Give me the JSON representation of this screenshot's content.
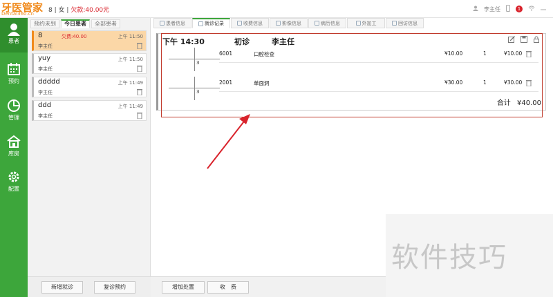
{
  "app": {
    "logo_cn": "牙医管家",
    "logo_en": "Dental360.cn"
  },
  "patient_bar": {
    "id": "8",
    "sep1": "|",
    "gender": "女",
    "sep2": "|",
    "owe": "欠款:40.00元"
  },
  "top_right": {
    "user": "李主任",
    "badge": "1"
  },
  "sidebar": {
    "items": [
      {
        "label": "患者",
        "icon": "user-icon"
      },
      {
        "label": "预约",
        "icon": "calendar-icon"
      },
      {
        "label": "管理",
        "icon": "pie-chart-icon"
      },
      {
        "label": "库房",
        "icon": "warehouse-icon"
      },
      {
        "label": "配置",
        "icon": "gear-icon"
      }
    ]
  },
  "patient_tabs": [
    "预约未到",
    "今日患者",
    "全部患者"
  ],
  "patients": [
    {
      "name": "8",
      "owe": "欠费:40.00",
      "time": "上午 11:50",
      "doctor": "李主任"
    },
    {
      "name": "yuy",
      "owe": "",
      "time": "上午 11:50",
      "doctor": "李主任"
    },
    {
      "name": "ddddd",
      "owe": "",
      "time": "上午 11:49",
      "doctor": "李主任"
    },
    {
      "name": "ddd",
      "owe": "",
      "time": "上午 11:49",
      "doctor": "李主任"
    }
  ],
  "patient_buttons": {
    "new_visit": "新增就诊",
    "revisit": "复诊预约"
  },
  "main_tabs": [
    "患者信息",
    "就诊记录",
    "收费信息",
    "影像信息",
    "病历信息",
    "外加工",
    "回访信息"
  ],
  "record": {
    "time": "下午 14:30",
    "type": "初诊",
    "doctor": "李主任",
    "items": [
      {
        "tooth": "3",
        "code": "6001",
        "name": "口腔检查",
        "price": "¥10.00",
        "qty": "1",
        "amount": "¥10.00"
      },
      {
        "tooth": "3",
        "code": "2001",
        "name": "单面洞",
        "price": "¥30.00",
        "qty": "1",
        "amount": "¥30.00"
      }
    ],
    "total_label": "合计",
    "total_value": "¥40.00"
  },
  "main_buttons": {
    "add": "增加处置",
    "charge": "收　费"
  },
  "watermark": "软件技巧",
  "colors": {
    "accent_green": "#3da63b",
    "brand_orange": "#f08a1c",
    "alert_red": "#d9232c",
    "selected_card": "#fbd7a7"
  }
}
